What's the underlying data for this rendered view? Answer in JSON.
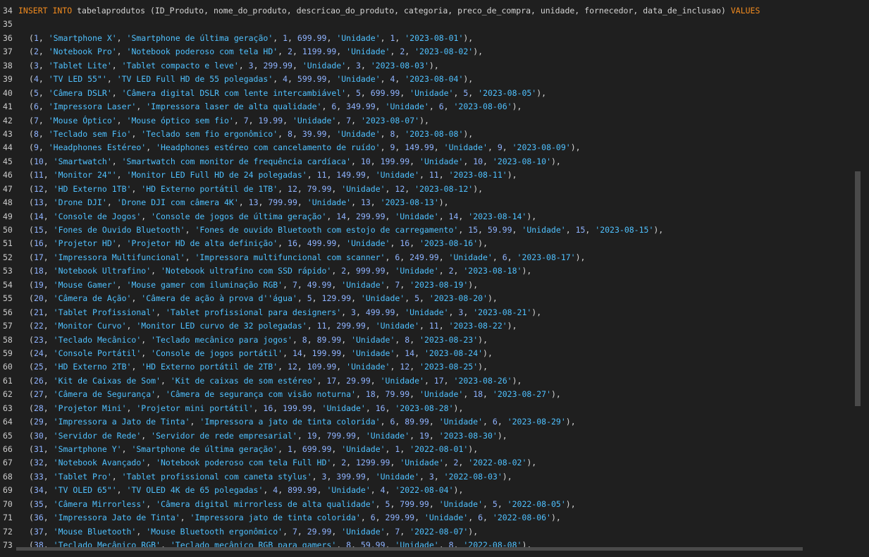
{
  "editor": {
    "header": {
      "line_number": "34",
      "insert": "INSERT INTO",
      "table": " tabelaprodutos (ID_Produto, nome_do_produto, descricao_do_produto, categoria, preco_de_compra, unidade, fornecedor, data_de_inclusao) ",
      "values": "VALUES"
    },
    "blank_line": "35",
    "rows": [
      {
        "ln": "36",
        "id": "1",
        "name": "'Smartphone X'",
        "desc": "'Smartphone de última geração'",
        "cat": "1",
        "price": "699.99",
        "unit": "'Unidade'",
        "supplier": "1",
        "date": "'2023-08-01'"
      },
      {
        "ln": "37",
        "id": "2",
        "name": "'Notebook Pro'",
        "desc": "'Notebook poderoso com tela HD'",
        "cat": "2",
        "price": "1199.99",
        "unit": "'Unidade'",
        "supplier": "2",
        "date": "'2023-08-02'"
      },
      {
        "ln": "38",
        "id": "3",
        "name": "'Tablet Lite'",
        "desc": "'Tablet compacto e leve'",
        "cat": "3",
        "price": "299.99",
        "unit": "'Unidade'",
        "supplier": "3",
        "date": "'2023-08-03'"
      },
      {
        "ln": "39",
        "id": "4",
        "name": "'TV LED 55\"'",
        "desc": "'TV LED Full HD de 55 polegadas'",
        "cat": "4",
        "price": "599.99",
        "unit": "'Unidade'",
        "supplier": "4",
        "date": "'2023-08-04'"
      },
      {
        "ln": "40",
        "id": "5",
        "name": "'Câmera DSLR'",
        "desc": "'Câmera digital DSLR com lente intercambiável'",
        "cat": "5",
        "price": "699.99",
        "unit": "'Unidade'",
        "supplier": "5",
        "date": "'2023-08-05'"
      },
      {
        "ln": "41",
        "id": "6",
        "name": "'Impressora Laser'",
        "desc": "'Impressora laser de alta qualidade'",
        "cat": "6",
        "price": "349.99",
        "unit": "'Unidade'",
        "supplier": "6",
        "date": "'2023-08-06'"
      },
      {
        "ln": "42",
        "id": "7",
        "name": "'Mouse Óptico'",
        "desc": "'Mouse óptico sem fio'",
        "cat": "7",
        "price": "19.99",
        "unit": "'Unidade'",
        "supplier": "7",
        "date": "'2023-08-07'"
      },
      {
        "ln": "43",
        "id": "8",
        "name": "'Teclado sem Fio'",
        "desc": "'Teclado sem fio ergonômico'",
        "cat": "8",
        "price": "39.99",
        "unit": "'Unidade'",
        "supplier": "8",
        "date": "'2023-08-08'"
      },
      {
        "ln": "44",
        "id": "9",
        "name": "'Headphones Estéreo'",
        "desc": "'Headphones estéreo com cancelamento de ruído'",
        "cat": "9",
        "price": "149.99",
        "unit": "'Unidade'",
        "supplier": "9",
        "date": "'2023-08-09'"
      },
      {
        "ln": "45",
        "id": "10",
        "name": "'Smartwatch'",
        "desc": "'Smartwatch com monitor de frequência cardíaca'",
        "cat": "10",
        "price": "199.99",
        "unit": "'Unidade'",
        "supplier": "10",
        "date": "'2023-08-10'"
      },
      {
        "ln": "46",
        "id": "11",
        "name": "'Monitor 24\"'",
        "desc": "'Monitor LED Full HD de 24 polegadas'",
        "cat": "11",
        "price": "149.99",
        "unit": "'Unidade'",
        "supplier": "11",
        "date": "'2023-08-11'"
      },
      {
        "ln": "47",
        "id": "12",
        "name": "'HD Externo 1TB'",
        "desc": "'HD Externo portátil de 1TB'",
        "cat": "12",
        "price": "79.99",
        "unit": "'Unidade'",
        "supplier": "12",
        "date": "'2023-08-12'"
      },
      {
        "ln": "48",
        "id": "13",
        "name": "'Drone DJI'",
        "desc": "'Drone DJI com câmera 4K'",
        "cat": "13",
        "price": "799.99",
        "unit": "'Unidade'",
        "supplier": "13",
        "date": "'2023-08-13'"
      },
      {
        "ln": "49",
        "id": "14",
        "name": "'Console de Jogos'",
        "desc": "'Console de jogos de última geração'",
        "cat": "14",
        "price": "299.99",
        "unit": "'Unidade'",
        "supplier": "14",
        "date": "'2023-08-14'"
      },
      {
        "ln": "50",
        "id": "15",
        "name": "'Fones de Ouvido Bluetooth'",
        "desc": "'Fones de ouvido Bluetooth com estojo de carregamento'",
        "cat": "15",
        "price": "59.99",
        "unit": "'Unidade'",
        "supplier": "15",
        "date": "'2023-08-15'"
      },
      {
        "ln": "51",
        "id": "16",
        "name": "'Projetor HD'",
        "desc": "'Projetor HD de alta definição'",
        "cat": "16",
        "price": "499.99",
        "unit": "'Unidade'",
        "supplier": "16",
        "date": "'2023-08-16'"
      },
      {
        "ln": "52",
        "id": "17",
        "name": "'Impressora Multifuncional'",
        "desc": "'Impressora multifuncional com scanner'",
        "cat": "6",
        "price": "249.99",
        "unit": "'Unidade'",
        "supplier": "6",
        "date": "'2023-08-17'"
      },
      {
        "ln": "53",
        "id": "18",
        "name": "'Notebook Ultrafino'",
        "desc": "'Notebook ultrafino com SSD rápido'",
        "cat": "2",
        "price": "999.99",
        "unit": "'Unidade'",
        "supplier": "2",
        "date": "'2023-08-18'"
      },
      {
        "ln": "54",
        "id": "19",
        "name": "'Mouse Gamer'",
        "desc": "'Mouse gamer com iluminação RGB'",
        "cat": "7",
        "price": "49.99",
        "unit": "'Unidade'",
        "supplier": "7",
        "date": "'2023-08-19'"
      },
      {
        "ln": "55",
        "id": "20",
        "name": "'Câmera de Ação'",
        "desc": "'Câmera de ação à prova d''água'",
        "cat": "5",
        "price": "129.99",
        "unit": "'Unidade'",
        "supplier": "5",
        "date": "'2023-08-20'"
      },
      {
        "ln": "56",
        "id": "21",
        "name": "'Tablet Profissional'",
        "desc": "'Tablet profissional para designers'",
        "cat": "3",
        "price": "499.99",
        "unit": "'Unidade'",
        "supplier": "3",
        "date": "'2023-08-21'"
      },
      {
        "ln": "57",
        "id": "22",
        "name": "'Monitor Curvo'",
        "desc": "'Monitor LED curvo de 32 polegadas'",
        "cat": "11",
        "price": "299.99",
        "unit": "'Unidade'",
        "supplier": "11",
        "date": "'2023-08-22'"
      },
      {
        "ln": "58",
        "id": "23",
        "name": "'Teclado Mecânico'",
        "desc": "'Teclado mecânico para jogos'",
        "cat": "8",
        "price": "89.99",
        "unit": "'Unidade'",
        "supplier": "8",
        "date": "'2023-08-23'"
      },
      {
        "ln": "59",
        "id": "24",
        "name": "'Console Portátil'",
        "desc": "'Console de jogos portátil'",
        "cat": "14",
        "price": "199.99",
        "unit": "'Unidade'",
        "supplier": "14",
        "date": "'2023-08-24'"
      },
      {
        "ln": "60",
        "id": "25",
        "name": "'HD Externo 2TB'",
        "desc": "'HD Externo portátil de 2TB'",
        "cat": "12",
        "price": "109.99",
        "unit": "'Unidade'",
        "supplier": "12",
        "date": "'2023-08-25'"
      },
      {
        "ln": "61",
        "id": "26",
        "name": "'Kit de Caixas de Som'",
        "desc": "'Kit de caixas de som estéreo'",
        "cat": "17",
        "price": "29.99",
        "unit": "'Unidade'",
        "supplier": "17",
        "date": "'2023-08-26'"
      },
      {
        "ln": "62",
        "id": "27",
        "name": "'Câmera de Segurança'",
        "desc": "'Câmera de segurança com visão noturna'",
        "cat": "18",
        "price": "79.99",
        "unit": "'Unidade'",
        "supplier": "18",
        "date": "'2023-08-27'"
      },
      {
        "ln": "63",
        "id": "28",
        "name": "'Projetor Mini'",
        "desc": "'Projetor mini portátil'",
        "cat": "16",
        "price": "199.99",
        "unit": "'Unidade'",
        "supplier": "16",
        "date": "'2023-08-28'"
      },
      {
        "ln": "64",
        "id": "29",
        "name": "'Impressora a Jato de Tinta'",
        "desc": "'Impressora a jato de tinta colorida'",
        "cat": "6",
        "price": "89.99",
        "unit": "'Unidade'",
        "supplier": "6",
        "date": "'2023-08-29'"
      },
      {
        "ln": "65",
        "id": "30",
        "name": "'Servidor de Rede'",
        "desc": "'Servidor de rede empresarial'",
        "cat": "19",
        "price": "799.99",
        "unit": "'Unidade'",
        "supplier": "19",
        "date": "'2023-08-30'"
      },
      {
        "ln": "66",
        "id": "31",
        "name": "'Smartphone Y'",
        "desc": "'Smartphone de última geração'",
        "cat": "1",
        "price": "699.99",
        "unit": "'Unidade'",
        "supplier": "1",
        "date": "'2022-08-01'"
      },
      {
        "ln": "67",
        "id": "32",
        "name": "'Notebook Avançado'",
        "desc": "'Notebook poderoso com tela Full HD'",
        "cat": "2",
        "price": "1299.99",
        "unit": "'Unidade'",
        "supplier": "2",
        "date": "'2022-08-02'"
      },
      {
        "ln": "68",
        "id": "33",
        "name": "'Tablet Pro'",
        "desc": "'Tablet profissional com caneta stylus'",
        "cat": "3",
        "price": "399.99",
        "unit": "'Unidade'",
        "supplier": "3",
        "date": "'2022-08-03'"
      },
      {
        "ln": "69",
        "id": "34",
        "name": "'TV OLED 65\"'",
        "desc": "'TV OLED 4K de 65 polegadas'",
        "cat": "4",
        "price": "899.99",
        "unit": "'Unidade'",
        "supplier": "4",
        "date": "'2022-08-04'"
      },
      {
        "ln": "70",
        "id": "35",
        "name": "'Câmera Mirrorless'",
        "desc": "'Câmera digital mirrorless de alta qualidade'",
        "cat": "5",
        "price": "799.99",
        "unit": "'Unidade'",
        "supplier": "5",
        "date": "'2022-08-05'"
      },
      {
        "ln": "71",
        "id": "36",
        "name": "'Impressora Jato de Tinta'",
        "desc": "'Impressora jato de tinta colorida'",
        "cat": "6",
        "price": "299.99",
        "unit": "'Unidade'",
        "supplier": "6",
        "date": "'2022-08-06'"
      },
      {
        "ln": "72",
        "id": "37",
        "name": "'Mouse Bluetooth'",
        "desc": "'Mouse Bluetooth ergonômico'",
        "cat": "7",
        "price": "29.99",
        "unit": "'Unidade'",
        "supplier": "7",
        "date": "'2022-08-07'"
      },
      {
        "ln": "73",
        "id": "38",
        "name": "'Teclado Mecânico RGB'",
        "desc": "'Teclado mecânico RGB para gamers'",
        "cat": "8",
        "price": "59.99",
        "unit": "'Unidade'",
        "supplier": "8",
        "date": "'2022-08-08'"
      }
    ],
    "colors": {
      "background": "#1f1f1f",
      "keyword": "#f28b1f",
      "string": "#4fc1ff",
      "number": "#8fb3ff",
      "text": "#d4d4d4",
      "line_number": "#cccccc",
      "scrollbar": "#4a4a4a"
    }
  }
}
